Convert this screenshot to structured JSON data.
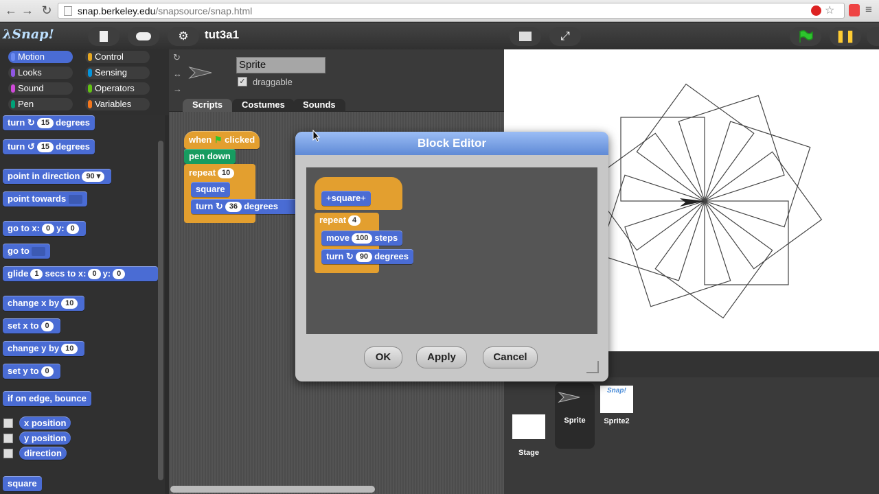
{
  "browser": {
    "url_host": "snap.berkeley.edu",
    "url_path": "/snapsource/snap.html",
    "back_icon": "back-arrow-icon",
    "forward_icon": "forward-arrow-icon",
    "reload_icon": "reload-icon",
    "extensions": [
      "adblock-icon",
      "star-icon",
      "extension-icon",
      "menu-icon"
    ]
  },
  "toolbar": {
    "logo": "λSnap!",
    "project_title": "tut3a1"
  },
  "categories": [
    {
      "label": "Motion",
      "color": "#4a6cd4",
      "selected": true
    },
    {
      "label": "Control",
      "color": "#e6a822"
    },
    {
      "label": "Looks",
      "color": "#8f56e3"
    },
    {
      "label": "Sensing",
      "color": "#0494dc"
    },
    {
      "label": "Sound",
      "color": "#cf4ad9"
    },
    {
      "label": "Operators",
      "color": "#62c213"
    },
    {
      "label": "Pen",
      "color": "#00a178"
    },
    {
      "label": "Variables",
      "color": "#f3761d"
    }
  ],
  "palette": {
    "turn_right": {
      "a": "turn",
      "n": "15",
      "b": "degrees"
    },
    "turn_left": {
      "a": "turn",
      "n": "15",
      "b": "degrees"
    },
    "point_dir": {
      "a": "point in direction",
      "n": "90"
    },
    "point_towards": {
      "a": "point towards"
    },
    "go_to_xy": {
      "a": "go to x:",
      "x": "0",
      "b": "y:",
      "y": "0"
    },
    "go_to": {
      "a": "go to"
    },
    "glide": {
      "a": "glide",
      "n": "1",
      "b": "secs to x:",
      "x": "0",
      "c": "y:",
      "y": "0"
    },
    "change_x": {
      "a": "change x by",
      "n": "10"
    },
    "set_x": {
      "a": "set x to",
      "n": "0"
    },
    "change_y": {
      "a": "change y by",
      "n": "10"
    },
    "set_y": {
      "a": "set y to",
      "n": "0"
    },
    "bounce": "if on edge, bounce",
    "x_position": "x position",
    "y_position": "y position",
    "direction": "direction",
    "square": "square"
  },
  "sprite": {
    "name": "Sprite",
    "draggable_label": "draggable",
    "draggable_checked": "✓"
  },
  "tabs": [
    "Scripts",
    "Costumes",
    "Sounds"
  ],
  "script": {
    "hat_when": "when",
    "hat_clicked": "clicked",
    "pen_down": "pen down",
    "repeat": "repeat",
    "repeat_n": "10",
    "custom": "square",
    "turn": "turn",
    "turn_n": "36",
    "turn_degrees": "degrees"
  },
  "dialog": {
    "title": "Block Editor",
    "prototype": "square",
    "repeat": "repeat",
    "repeat_n": "4",
    "move": "move",
    "move_n": "100",
    "steps": "steps",
    "turn": "turn",
    "turn_n": "90",
    "degrees": "degrees",
    "ok": "OK",
    "apply": "Apply",
    "cancel": "Cancel"
  },
  "corral": {
    "stage_label": "Stage",
    "sprites": [
      "Sprite",
      "Sprite2"
    ]
  },
  "colors": {
    "motion": "#4a6cd4",
    "control": "#e39f2f",
    "pen": "#179c60",
    "flag": "#2dc52d"
  }
}
